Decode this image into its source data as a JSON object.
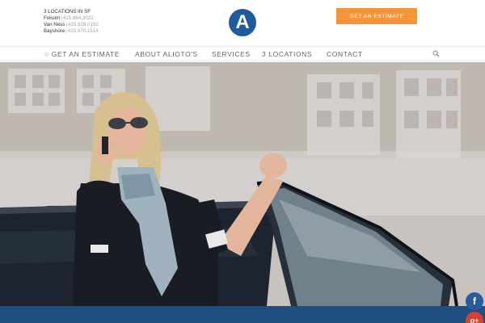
{
  "header": {
    "locations_title": "3 LOCATIONS IN SF",
    "locations": [
      {
        "name": "Folsom",
        "phone": "415.864.3022"
      },
      {
        "name": "Van Ness",
        "phone": "415.928.0192"
      },
      {
        "name": "Bayshore",
        "phone": "415.970.1514"
      }
    ],
    "logo_letter": "A",
    "estimate_button": "GET AN ESTIMATE"
  },
  "nav": {
    "items": [
      {
        "label": "GET AN ESTIMATE",
        "icon": "star-icon"
      },
      {
        "label": "ABOUT ALIOTO'S"
      },
      {
        "label": "SERVICES"
      },
      {
        "label": "3 LOCATIONS"
      },
      {
        "label": "CONTACT"
      }
    ],
    "search_icon": "search-icon"
  },
  "hero": {
    "image": "woman-on-phone-leaning-on-car-door"
  },
  "social": {
    "facebook": "f",
    "googleplus": "g+"
  },
  "colors": {
    "accent": "#f7953a",
    "brand_blue": "#1e5a9c",
    "footer_blue": "#1f4f82",
    "facebook": "#2c5aa0",
    "googleplus": "#d6422f"
  }
}
